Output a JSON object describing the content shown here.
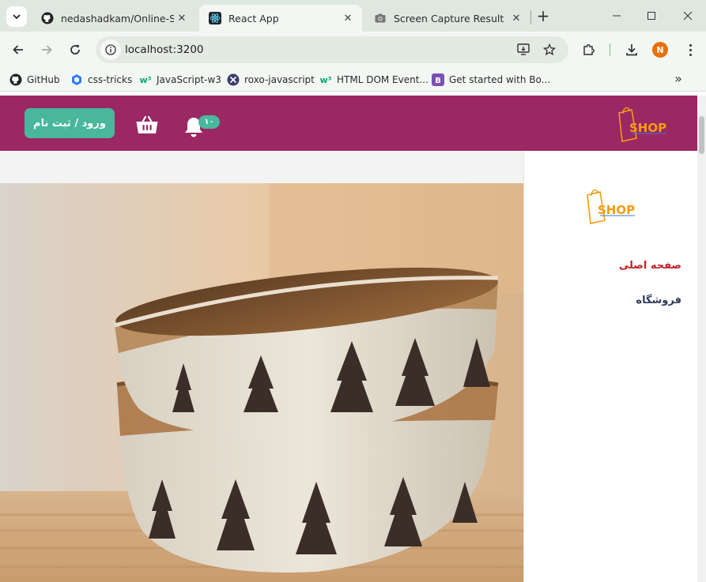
{
  "browser": {
    "tabs": [
      {
        "title": "nedashadkam/Online-Shop",
        "icon": "github-icon",
        "active": false
      },
      {
        "title": "React App",
        "icon": "react-icon",
        "active": true
      },
      {
        "title": "Screen Capture Result",
        "icon": "camera-icon",
        "active": false
      }
    ],
    "new_tab_label": "+",
    "url": "localhost:3200",
    "profile_initial": "N",
    "profile_color": "#e8710a",
    "bookmarks": [
      {
        "label": "GitHub",
        "icon": "github-icon"
      },
      {
        "label": "css-tricks",
        "icon": "css-tricks-icon"
      },
      {
        "label": "JavaScript-w3",
        "icon": "w3-icon"
      },
      {
        "label": "roxo-javascript",
        "icon": "roxo-icon"
      },
      {
        "label": "HTML DOM Event...",
        "icon": "w3-icon"
      },
      {
        "label": "Get started with Bo...",
        "icon": "bootstrap-icon"
      }
    ],
    "bookmarks_overflow": "»"
  },
  "site": {
    "header_color": "#9b2863",
    "accent_color": "#49b79d",
    "login_label": "ورود / ثبت نام",
    "notification_count": "۱۰",
    "logo_text": "SHOP",
    "nav": {
      "home": "صفحه اصلی",
      "shop": "فروشگاه"
    },
    "hero_alt": "ceramic bowls with pine tree pattern"
  }
}
